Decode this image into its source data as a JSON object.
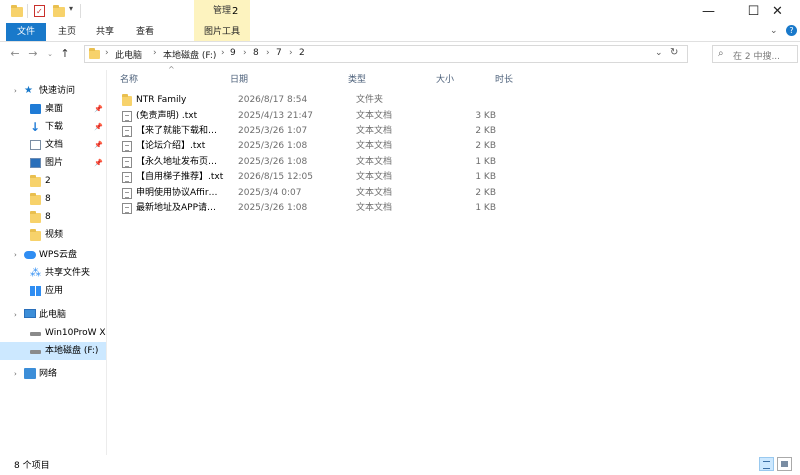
{
  "title_bar": {
    "context_tab_header": "管理",
    "window_title": "2"
  },
  "ribbon": {
    "tabs": [
      "文件",
      "主页",
      "共享",
      "查看",
      "图片工具"
    ]
  },
  "address": {
    "crumbs": [
      "此电脑",
      "本地磁盘 (F:)",
      "9",
      "8",
      "7",
      "2"
    ],
    "search_placeholder": "在 2 中搜..."
  },
  "nav_pane": {
    "items": [
      {
        "label": "快速访问",
        "icon": "star-icon",
        "pinned": false
      },
      {
        "label": "桌面",
        "icon": "desktop-icon",
        "pinned": true
      },
      {
        "label": "下载",
        "icon": "download-icon",
        "pinned": true
      },
      {
        "label": "文档",
        "icon": "document-icon",
        "pinned": true
      },
      {
        "label": "图片",
        "icon": "picture-icon",
        "pinned": true
      },
      {
        "label": "2",
        "icon": "folder-icon",
        "pinned": false
      },
      {
        "label": "8",
        "icon": "folder-icon",
        "pinned": false
      },
      {
        "label": "8",
        "icon": "folder-icon",
        "pinned": false
      },
      {
        "label": "视频",
        "icon": "folder-icon",
        "pinned": false
      },
      {
        "label": "WPS云盘",
        "icon": "cloud-icon",
        "pinned": false
      },
      {
        "label": "共享文件夹",
        "icon": "shared-folder-icon",
        "pinned": false
      },
      {
        "label": "应用",
        "icon": "apps-icon",
        "pinned": false
      },
      {
        "label": "此电脑",
        "icon": "computer-icon",
        "pinned": false
      },
      {
        "label": "Win10ProW X",
        "icon": "drive-icon",
        "pinned": false
      },
      {
        "label": "本地磁盘 (F:)",
        "icon": "drive-icon",
        "pinned": false
      },
      {
        "label": "网络",
        "icon": "network-icon",
        "pinned": false
      }
    ]
  },
  "columns": [
    "名称",
    "日期",
    "类型",
    "大小",
    "时长"
  ],
  "files": [
    {
      "name": "NTR Family",
      "date": "2026/8/17 8:54",
      "type": "文件夹",
      "size": "",
      "kind": "folder"
    },
    {
      "name": "(免责声明) .txt",
      "date": "2025/4/13 21:47",
      "type": "文本文档",
      "size": "3 KB",
      "kind": "txt"
    },
    {
      "name": "【来了就能下载和…",
      "date": "2025/3/26 1:07",
      "type": "文本文档",
      "size": "2 KB",
      "kind": "txt"
    },
    {
      "name": "【论坛介绍】.txt",
      "date": "2025/3/26 1:08",
      "type": "文本文档",
      "size": "2 KB",
      "kind": "txt"
    },
    {
      "name": "【永久地址发布页…",
      "date": "2025/3/26 1:08",
      "type": "文本文档",
      "size": "1 KB",
      "kind": "txt"
    },
    {
      "name": "【自用梯子推荐】.txt",
      "date": "2026/8/15 12:05",
      "type": "文本文档",
      "size": "1 KB",
      "kind": "txt"
    },
    {
      "name": "申明使用协议Affir…",
      "date": "2025/3/4 0:07",
      "type": "文本文档",
      "size": "2 KB",
      "kind": "txt"
    },
    {
      "name": "最新地址及APP请…",
      "date": "2025/3/26 1:08",
      "type": "文本文档",
      "size": "1 KB",
      "kind": "txt"
    }
  ],
  "status": {
    "item_count": "8 个项目"
  }
}
